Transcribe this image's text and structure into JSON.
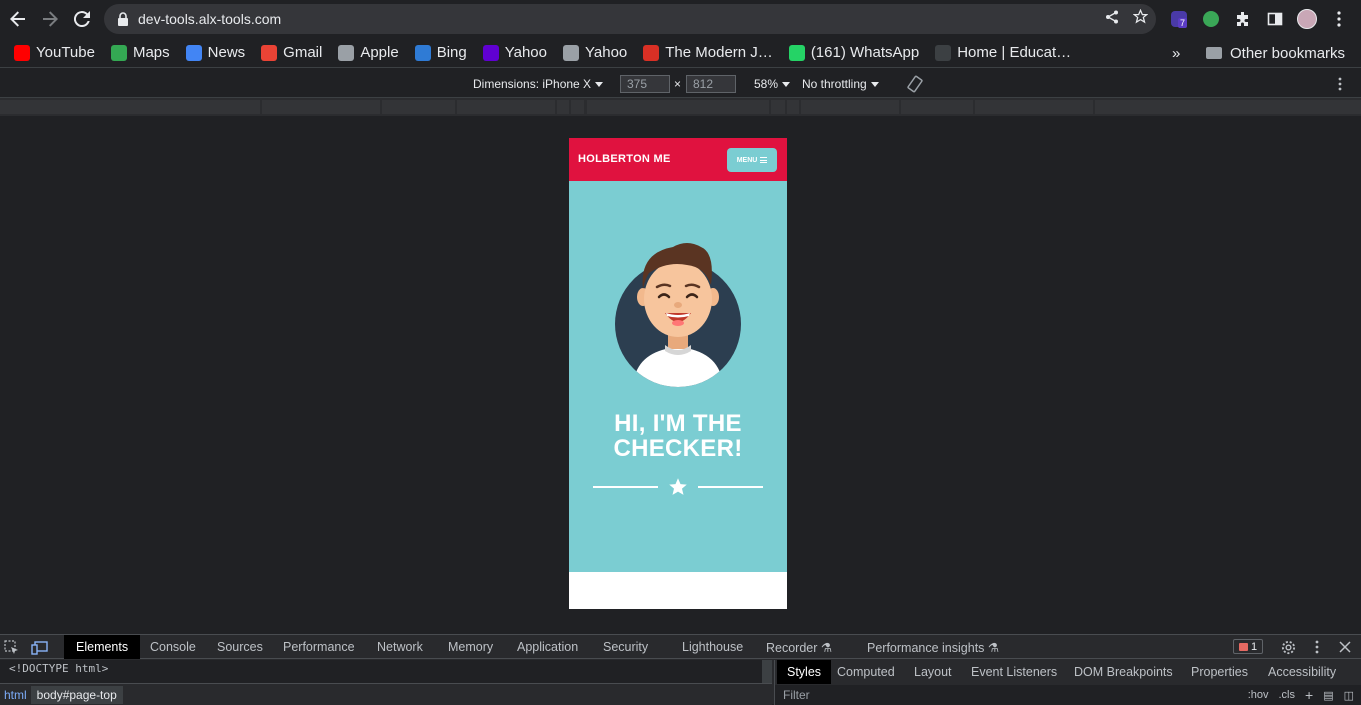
{
  "browser": {
    "url": "dev-tools.alx-tools.com",
    "extension_badge": "7"
  },
  "bookmarks": [
    {
      "label": "YouTube",
      "icon": "youtube-icon",
      "color": "#ff0000"
    },
    {
      "label": "Maps",
      "icon": "maps-icon",
      "color": "#34a853"
    },
    {
      "label": "News",
      "icon": "news-icon",
      "color": "#4285f4"
    },
    {
      "label": "Gmail",
      "icon": "gmail-icon",
      "color": "#ea4335"
    },
    {
      "label": "Apple",
      "icon": "apple-icon",
      "color": "#9aa0a6"
    },
    {
      "label": "Bing",
      "icon": "bing-icon",
      "color": "#2f7bd5"
    },
    {
      "label": "Yahoo",
      "icon": "yahoo-icon",
      "color": "#6001d2"
    },
    {
      "label": "Yahoo",
      "icon": "globe-icon",
      "color": "#9aa0a6"
    },
    {
      "label": "The Modern J…",
      "icon": "modern-icon",
      "color": "#d93025"
    },
    {
      "label": "(161) WhatsApp",
      "icon": "whatsapp-icon",
      "color": "#25d366"
    },
    {
      "label": "Home | Educat…",
      "icon": "terminal-icon",
      "color": "#3c4043"
    }
  ],
  "bookmarks_more": "»",
  "other_bookmarks": "Other bookmarks",
  "device_toolbar": {
    "dimensions_label": "Dimensions: iPhone X",
    "width": "375",
    "times": "×",
    "height": "812",
    "zoom": "58%",
    "throttling": "No throttling"
  },
  "site": {
    "brand": "HOLBERTON ME",
    "menu_label": "MENU",
    "hero_title_line1": "HI, I'M THE",
    "hero_title_line2": "CHECKER!",
    "colors": {
      "header": "#e0123f",
      "hero": "#7bcdd2"
    }
  },
  "devtools": {
    "tabs": [
      "Elements",
      "Console",
      "Sources",
      "Performance",
      "Network",
      "Memory",
      "Application",
      "Security",
      "Lighthouse",
      "Recorder ⚗",
      "Performance insights ⚗"
    ],
    "error_count": "1",
    "doctype": "<!DOCTYPE html>",
    "crumb_html": "html",
    "crumb_body": "body#page-top",
    "styles_tabs": [
      "Styles",
      "Computed",
      "Layout",
      "Event Listeners",
      "DOM Breakpoints",
      "Properties",
      "Accessibility"
    ],
    "filter_placeholder": "Filter",
    "hov": ":hov",
    "cls": ".cls"
  }
}
